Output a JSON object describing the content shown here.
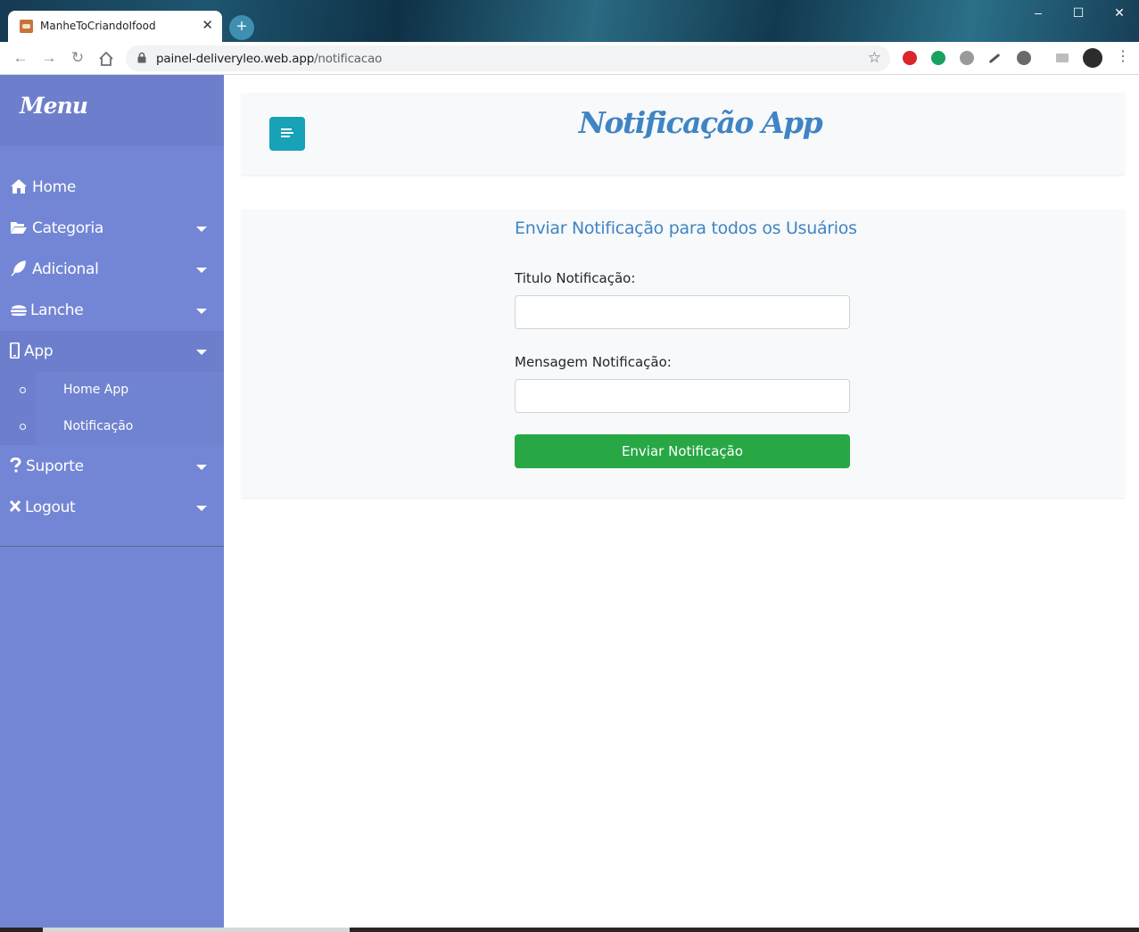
{
  "browser": {
    "tab_title": "ManheToCriandoIfood",
    "tab_close": "✕",
    "new_tab": "+",
    "url_host": "painel-deliveryleo.web.app",
    "url_path": "/notificacao",
    "window_controls": {
      "minimize": "–",
      "maximize": "☐",
      "close": "✕"
    }
  },
  "sidebar": {
    "title": "Menu",
    "items": [
      {
        "label": "Home",
        "icon": "home-icon",
        "has_caret": false
      },
      {
        "label": "Categoria",
        "icon": "folder-open-icon",
        "has_caret": true
      },
      {
        "label": "Adicional",
        "icon": "feather-icon",
        "has_caret": true
      },
      {
        "label": "Lanche",
        "icon": "hamburger-icon",
        "has_caret": true
      },
      {
        "label": "App",
        "icon": "mobile-icon",
        "has_caret": true,
        "expanded": true,
        "children": [
          {
            "label": "Home App"
          },
          {
            "label": "Notificação"
          }
        ]
      },
      {
        "label": "Suporte",
        "icon": "question-icon",
        "has_caret": true
      },
      {
        "label": "Logout",
        "icon": "times-icon",
        "has_caret": true
      }
    ]
  },
  "header": {
    "title": "Notificação App"
  },
  "form": {
    "heading": "Enviar Notificação para todos os Usuários",
    "title_label": "Titulo Notificação:",
    "title_value": "",
    "message_label": "Mensagem Notificação:",
    "message_value": "",
    "submit_label": "Enviar Notificação"
  },
  "colors": {
    "sidebar_bg": "#7386d5",
    "sidebar_active": "#6d7fcc",
    "title_blue": "#3f84c5",
    "toggle_teal": "#17a2b8",
    "submit_green": "#28a745"
  }
}
